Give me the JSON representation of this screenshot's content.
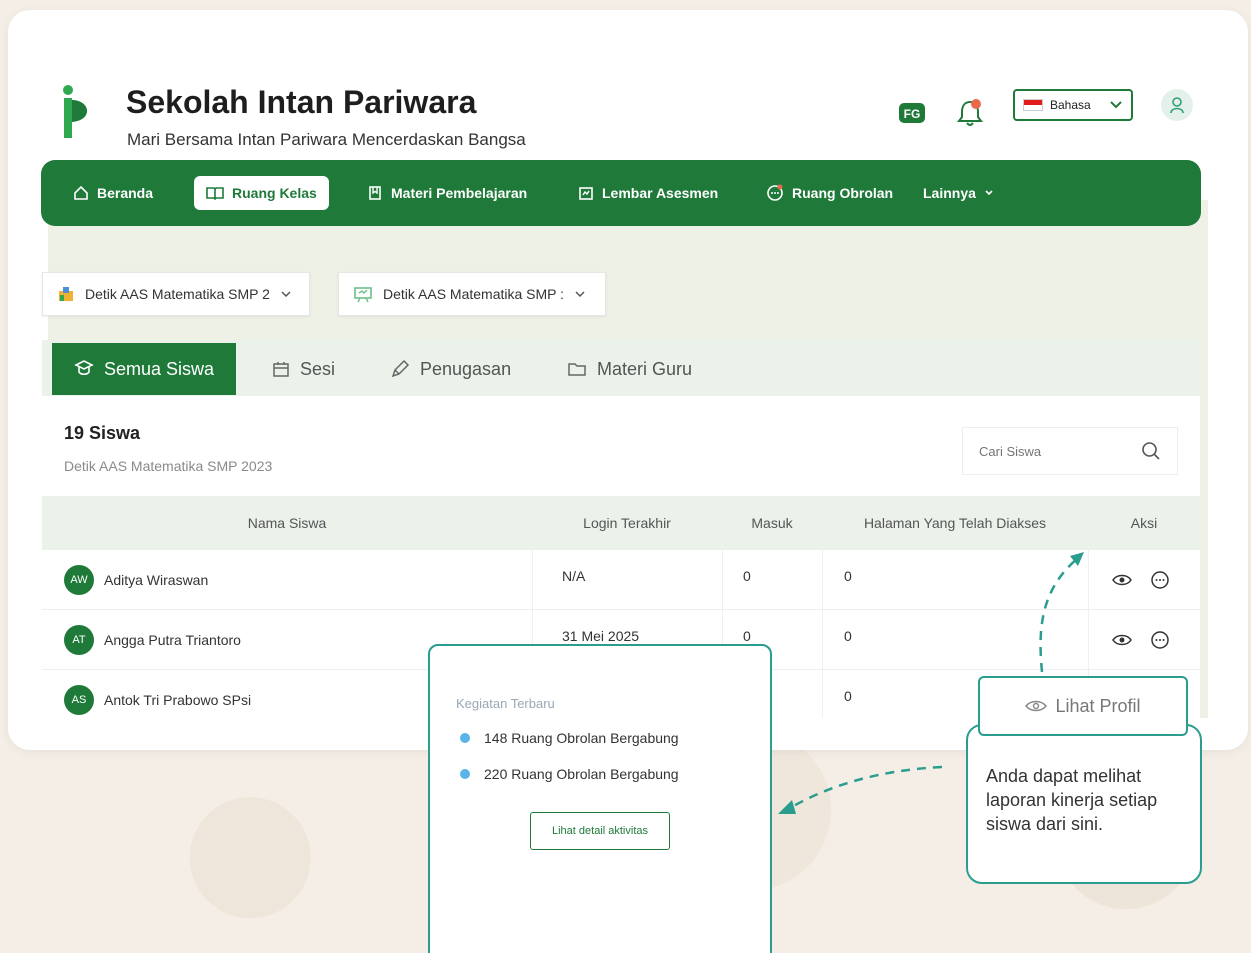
{
  "header": {
    "title": "Sekolah Intan Pariwara",
    "subtitle": "Mari Bersama Intan Pariwara Mencerdaskan Bangsa",
    "fg_badge": "FG",
    "language_label": "Bahasa"
  },
  "nav": {
    "items": [
      {
        "label": "Beranda",
        "icon": "home-icon"
      },
      {
        "label": "Ruang Kelas",
        "icon": "book-open-icon"
      },
      {
        "label": "Materi Pembelajaran",
        "icon": "book-icon"
      },
      {
        "label": "Lembar Asesmen",
        "icon": "clipboard-icon"
      },
      {
        "label": "Ruang Obrolan",
        "icon": "chat-icon"
      },
      {
        "label": "Lainnya",
        "icon": "chevron-down-icon"
      }
    ],
    "active_index": 1
  },
  "selectors": {
    "class_select": "Detik AAS Matematika SMP 2",
    "material_select": "Detik AAS Matematika SMP :"
  },
  "tabs": [
    {
      "label": "Semua Siswa",
      "icon": "student-icon"
    },
    {
      "label": "Sesi",
      "icon": "calendar-icon"
    },
    {
      "label": "Penugasan",
      "icon": "pen-icon"
    },
    {
      "label": "Materi Guru",
      "icon": "folder-icon"
    }
  ],
  "summary": {
    "count": "19 Siswa",
    "class_name": "Detik AAS Matematika SMP 2023"
  },
  "search": {
    "placeholder": "Cari Siswa",
    "value": ""
  },
  "table": {
    "columns": [
      "Nama Siswa",
      "Login Terakhir",
      "Masuk",
      "Halaman Yang Telah Diakses",
      "Aksi"
    ],
    "rows": [
      {
        "initials": "AW",
        "name": "Aditya Wiraswan",
        "last_login": "N/A",
        "entries": "0",
        "pages": "0"
      },
      {
        "initials": "AT",
        "name": "Angga Putra Triantoro",
        "last_login": "31 Mei 2025",
        "entries": "0",
        "pages": "0"
      },
      {
        "initials": "AS",
        "name": "Antok Tri Prabowo SPsi",
        "last_login": "",
        "entries": "",
        "pages": "0"
      }
    ]
  },
  "activity_popup": {
    "title": "Kegiatan Terbaru",
    "items": [
      "148 Ruang Obrolan Bergabung",
      "220 Ruang Obrolan Bergabung"
    ],
    "button": "Lihat detail aktivitas"
  },
  "profile_popup": {
    "label": "Lihat Profil"
  },
  "tip_popup": {
    "text": "Anda dapat melihat laporan kinerja setiap siswa dari sini."
  },
  "colors": {
    "brand_green": "#1f7a3a",
    "accent_teal": "#2a9d8f",
    "dot_blue": "#5ab4e8"
  }
}
